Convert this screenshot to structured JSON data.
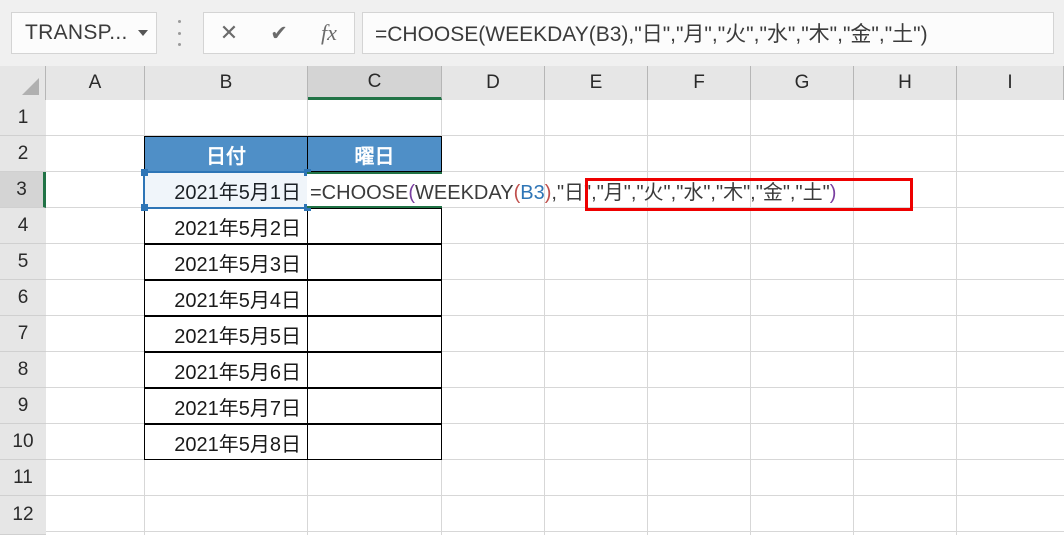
{
  "app": "excel-spreadsheet",
  "formula_bar": {
    "name_box_value": "TRANSP...",
    "name_box_icon": "chevron-down-icon",
    "cancel_icon": "✕",
    "enter_icon": "✔",
    "insert_function_icon": "fx",
    "formula_text": "=CHOOSE(WEEKDAY(B3),\"日\",\"月\",\"火\",\"水\",\"木\",\"金\",\"土\")"
  },
  "grid": {
    "columns": [
      "A",
      "B",
      "C",
      "D",
      "E",
      "F",
      "G",
      "H",
      "I"
    ],
    "active_column": "C",
    "rows": [
      "1",
      "2",
      "3",
      "4",
      "5",
      "6",
      "7",
      "8",
      "9",
      "10",
      "11",
      "12"
    ],
    "active_row": "3"
  },
  "table": {
    "headers": {
      "b2": "日付",
      "c2": "曜日"
    },
    "dates": [
      "2021年5月1日",
      "2021年5月2日",
      "2021年5月3日",
      "2021年5月4日",
      "2021年5月5日",
      "2021年5月6日",
      "2021年5月7日",
      "2021年5月8日"
    ]
  },
  "cell_edit": {
    "target_cell": "C3",
    "tokens": [
      {
        "text": "=CHOOSE",
        "kind": "plain"
      },
      {
        "text": "(",
        "kind": "p1"
      },
      {
        "text": "WEEKDAY",
        "kind": "plain"
      },
      {
        "text": "(",
        "kind": "p2"
      },
      {
        "text": "B3",
        "kind": "ref"
      },
      {
        "text": ")",
        "kind": "p2"
      },
      {
        "text": ",\"日\",\"月\",\"火\",\"水\",\"木\",\"金\",\"土\"",
        "kind": "plain"
      },
      {
        "text": ")",
        "kind": "p1"
      }
    ],
    "reference_cell": "B3"
  },
  "annotation": {
    "highlight_text": "\"日\",\"月\",\"火\",\"水\",\"木\",\"金\",\"土\")",
    "color": "#ee0000"
  },
  "colors": {
    "header_fill": "#4f8fc7",
    "reference_border": "#2e75b6",
    "edit_border": "#217346",
    "annotation": "#ee0000"
  }
}
